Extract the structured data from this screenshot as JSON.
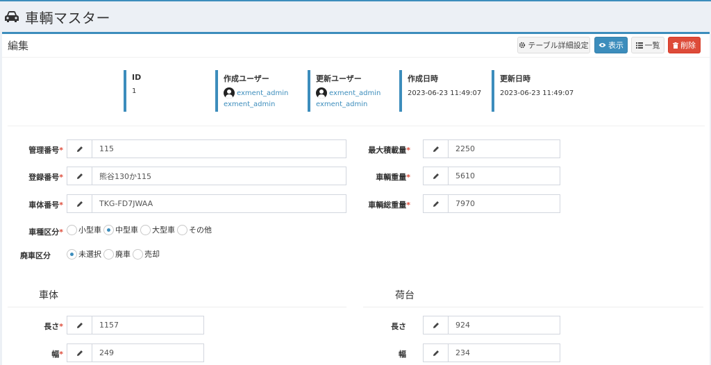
{
  "header": {
    "title": "車輌マスター"
  },
  "box": {
    "title": "編集"
  },
  "toolbar": {
    "table_settings_label": "テーブル詳細設定",
    "show_label": "表示",
    "list_label": "一覧",
    "delete_label": "削除"
  },
  "meta": {
    "id_label": "ID",
    "id_value": "1",
    "created_user_label": "作成ユーザー",
    "created_user_name": "exment_admin",
    "created_user_name2": "exment_admin",
    "updated_user_label": "更新ユーザー",
    "updated_user_name": "exment_admin",
    "updated_user_name2": "exment_admin",
    "created_at_label": "作成日時",
    "created_at_value": "2023-06-23 11:49:07",
    "updated_at_label": "更新日時",
    "updated_at_value": "2023-06-23 11:49:07"
  },
  "fields": {
    "kanri_label": "管理番号",
    "kanri_value": "115",
    "toroku_label": "登録番号",
    "toroku_value": "熊谷130か115",
    "shatai_label": "車体番号",
    "shatai_value": "TKG-FD7JWAA",
    "saidai_label": "最大積載量",
    "saidai_value": "2250",
    "sharyo_label": "車輌重量",
    "sharyo_value": "5610",
    "soju_label": "車輌総重量",
    "soju_value": "7970",
    "required_mark": "*"
  },
  "shashu": {
    "label": "車種区分",
    "options": [
      "小型車",
      "中型車",
      "大型車",
      "その他"
    ],
    "selected": "中型車"
  },
  "haisha": {
    "label": "廃車区分",
    "options": [
      "未選択",
      "廃車",
      "売却"
    ],
    "selected": "未選択"
  },
  "body_section": {
    "title": "車体",
    "length_label": "長さ",
    "length_value": "1157",
    "width_label": "幅",
    "width_value": "249"
  },
  "bed_section": {
    "title": "荷台",
    "length_label": "長さ",
    "length_value": "924",
    "width_label": "幅",
    "width_value": "234"
  },
  "colors": {
    "accent": "#3c8dbc",
    "danger": "#dd4b39",
    "required": "#dd4b39"
  }
}
